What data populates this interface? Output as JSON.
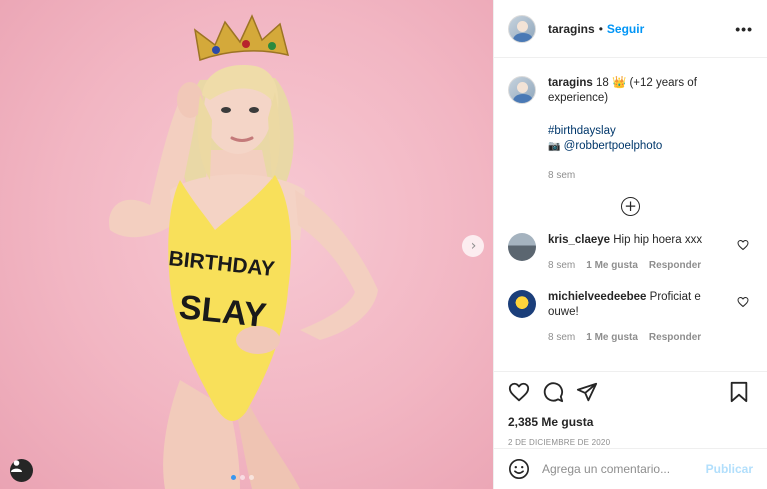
{
  "post": {
    "author": "taragins",
    "follow_separator": "•",
    "follow_label": "Seguir",
    "more_label": "•••",
    "carousel_next": "›"
  },
  "caption": {
    "username": "taragins",
    "text": "18 👑 (+12 years of experience)",
    "hashtag": "#birthdayslay",
    "camera_icon": "📷",
    "mention": "@robbertpoelphoto",
    "time": "8 sem"
  },
  "load_more_icon": "+",
  "comments": [
    {
      "username": "kris_claeye",
      "text": "Hip hip hoera xxx",
      "time": "8 sem",
      "likes": "1 Me gusta",
      "reply": "Responder"
    },
    {
      "username": "michielveedeebee",
      "text": "Proficiat e ouwe!",
      "time": "8 sem",
      "likes": "1 Me gusta",
      "reply": "Responder"
    }
  ],
  "stats": {
    "likes": "2,385 Me gusta",
    "date": "2 DE DICIEMBRE DE 2020"
  },
  "add_comment": {
    "placeholder": "Agrega un comentario...",
    "publish": "Publicar"
  },
  "photo": {
    "swimsuit_text_line1": "BIRTHDAY",
    "swimsuit_text_line2": "SLAY"
  },
  "icons": {
    "like": "heart-icon",
    "comment": "comment-icon",
    "share": "share-icon",
    "save": "bookmark-icon",
    "emoji": "emoji-icon",
    "user": "user-tag-icon",
    "crown": "crown"
  },
  "colors": {
    "link_blue": "#0095f6",
    "hashtag_blue": "#00376b",
    "background_pink": "#f2b6c3",
    "swimsuit_yellow": "#f8e05a"
  }
}
